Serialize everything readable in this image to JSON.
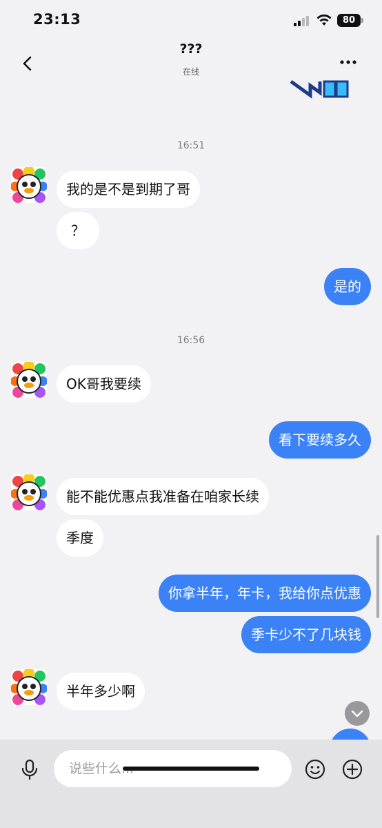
{
  "status_bar": {
    "time": "23:13",
    "battery": "80"
  },
  "nav": {
    "title": "???",
    "subtitle": "在线"
  },
  "timestamps": [
    "16:51",
    "16:56"
  ],
  "messages": [
    {
      "side": "in",
      "text": "我的是不是到期了哥"
    },
    {
      "side": "in",
      "text": "？"
    },
    {
      "side": "out",
      "text": "是的"
    },
    {
      "side": "in",
      "text": "OK哥我要续"
    },
    {
      "side": "out",
      "text": "看下要续多久"
    },
    {
      "side": "in",
      "text": "能不能优惠点我准备在咱家长续"
    },
    {
      "side": "in",
      "text": "季度"
    },
    {
      "side": "out",
      "text": "你拿半年，年卡，我给你点优惠"
    },
    {
      "side": "out",
      "text": "季卡少不了几块钱"
    },
    {
      "side": "in",
      "text": "半年多少啊"
    }
  ],
  "input": {
    "placeholder": "说些什么..."
  },
  "icons": {
    "back": "chevron-left-icon",
    "more": "more-icon",
    "mic": "microphone-icon",
    "emoji": "emoji-icon",
    "plus": "plus-icon",
    "scroll_down": "chevron-down-icon"
  },
  "colors": {
    "outgoing": "#3b82f6",
    "incoming": "#ffffff",
    "background": "#f2f2f4"
  }
}
